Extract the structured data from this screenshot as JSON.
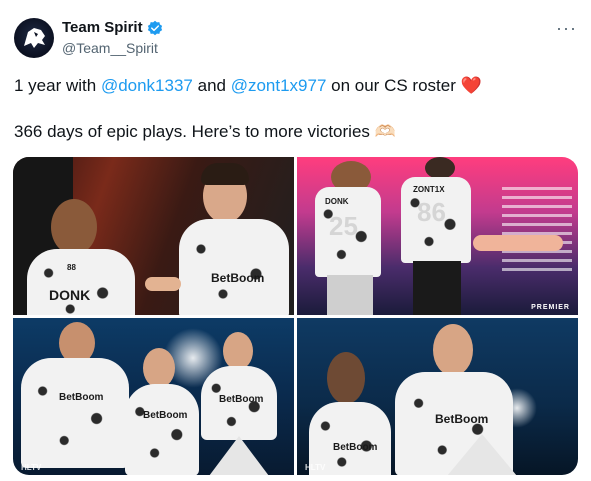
{
  "author": {
    "display_name": "Team Spirit",
    "handle": "@Team__Spirit",
    "verified": true,
    "avatar_icon": "dragon-logo-icon"
  },
  "menu": {
    "more_label": "···"
  },
  "tweet": {
    "line1": {
      "t1": "1 year with ",
      "mention1": "@donk1337",
      "t2": " and ",
      "mention2": "@zont1x977",
      "t3": " on our CS roster ",
      "emoji": "❤️"
    },
    "line2": {
      "text": "366 days of epic plays. Here’s to more victories ",
      "emoji": "🫶🏻"
    }
  },
  "media": {
    "photos": [
      {
        "jersey_name": "DONK",
        "jersey_number": "88",
        "sponsor": "BetBoom"
      },
      {
        "jersey_name": "DONK",
        "jersey_number": "25",
        "jersey_name2": "ZONT1X",
        "jersey_number2": "86",
        "logo_text": "PREMIER"
      },
      {
        "sponsor": "BetBoom",
        "watermark": "HLTV"
      },
      {
        "sponsor": "BetBoom",
        "watermark": "HLTV"
      }
    ]
  },
  "colors": {
    "link": "#1d9bf0",
    "verified": "#1d9bf0",
    "heart": "#e0245e",
    "muted": "#536471"
  }
}
